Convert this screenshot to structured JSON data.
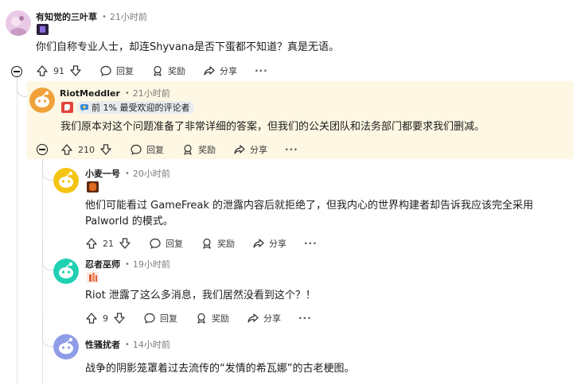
{
  "comments": [
    {
      "author": "有知觉的三叶草",
      "time": "21小时前",
      "text": "你们自称专业人士，却连Shyvana是否下蛋都不知道？真是无语。",
      "votes": "91",
      "avatar_color": "#e9c9e6"
    },
    {
      "author": "RiotMeddler",
      "time": "21小时前",
      "flair": "前 1% 最受欢迎的评论者",
      "text": "我们原本对这个问题准备了非常详细的答案，但我们的公关团队和法务部门都要求我们删减。",
      "votes": "210",
      "avatar_color": "#f0a13c"
    },
    {
      "author": "小麦一号",
      "time": "20小时前",
      "text_line1": "他们可能看过 GameFreak 的泄露内容后就拒绝了，但我内心的世界构建者却告诉我应该完全采用",
      "text_line2": "Palworld 的模式。",
      "votes": "21",
      "avatar_color": "#f3c412"
    },
    {
      "author": "忍者巫师",
      "time": "19小时前",
      "text": "Riot 泄露了这么多消息，我们居然没看到这个？！",
      "votes": "9",
      "avatar_color": "#1fd1b2"
    },
    {
      "author": "性骚扰者",
      "time": "14小时前",
      "text": "战争的阴影笼罩着过去流传的“发情的希瓦娜”的古老梗图。",
      "avatar_color": "#8f9de8"
    }
  ],
  "actions": {
    "reply": "回复",
    "award": "奖励",
    "share": "分享",
    "more": "···"
  }
}
